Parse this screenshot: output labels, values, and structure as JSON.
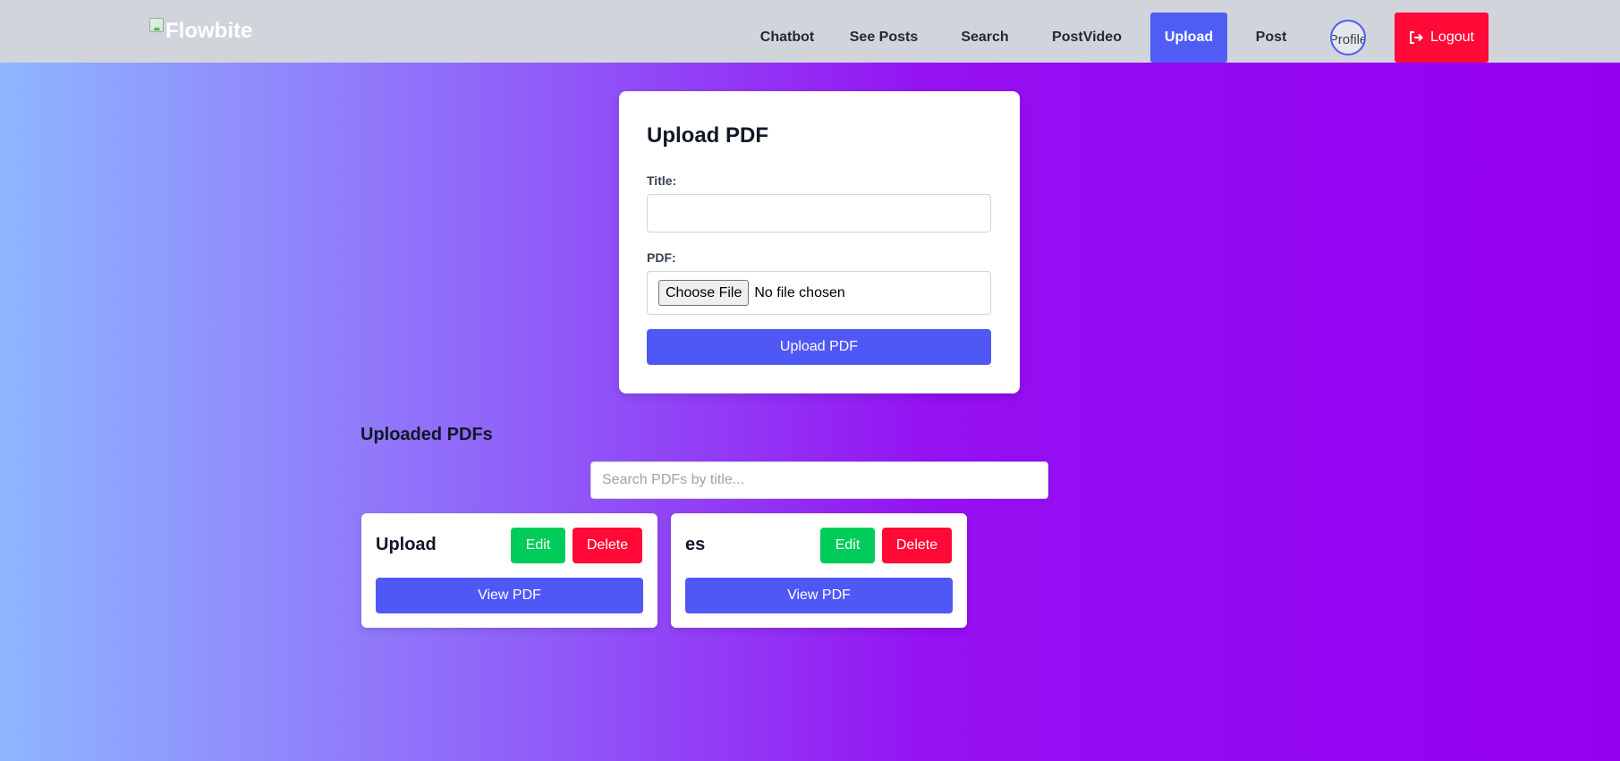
{
  "navbar": {
    "brand": "Flowbite",
    "links": [
      {
        "label": "Chatbot",
        "active": false
      },
      {
        "label": "See Posts",
        "active": false
      },
      {
        "label": "Search",
        "active": false
      },
      {
        "label": "PostVideo",
        "active": false
      },
      {
        "label": "Upload",
        "active": true
      },
      {
        "label": "Post",
        "active": false
      }
    ],
    "avatar_alt": "Profile",
    "logout_label": "Logout"
  },
  "upload_form": {
    "heading": "Upload PDF",
    "title_label": "Title:",
    "title_value": "",
    "pdf_label": "PDF:",
    "choose_file_label": "Choose File",
    "file_status": "No file chosen",
    "submit_label": "Upload PDF"
  },
  "uploaded": {
    "heading": "Uploaded PDFs",
    "search_placeholder": "Search PDFs by title...",
    "items": [
      {
        "title": "Upload",
        "edit_label": "Edit",
        "delete_label": "Delete",
        "view_label": "View PDF"
      },
      {
        "title": "es",
        "edit_label": "Edit",
        "delete_label": "Delete",
        "view_label": "View PDF"
      }
    ]
  },
  "colors": {
    "primary": "#4f58f5",
    "success": "#00cc5a",
    "danger": "#ff0a37",
    "navbar_bg": "#d1d5db"
  },
  "icons": {
    "logout": "sign-out-icon",
    "brand": "broken-image-icon"
  }
}
